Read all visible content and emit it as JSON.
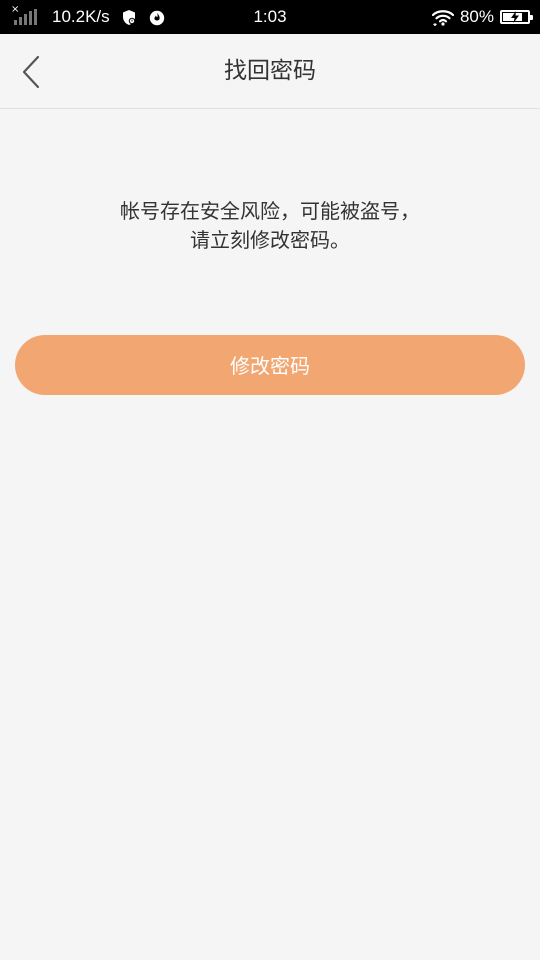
{
  "status_bar": {
    "net_speed": "10.2K/s",
    "time": "1:03",
    "battery_percent": "80%",
    "battery_level": 0.8,
    "signal_no_sim_mark": "×",
    "icons": [
      "signal-icon",
      "shield-icon",
      "fire-icon",
      "wifi-icon",
      "battery-charging-icon"
    ]
  },
  "nav": {
    "title": "找回密码",
    "back_icon": "chevron-left-icon"
  },
  "message": {
    "line1": "帐号存在安全风险，可能被盗号，",
    "line2": "请立刻修改密码。"
  },
  "action": {
    "change_password_label": "修改密码"
  },
  "colors": {
    "background": "#f5f5f6",
    "button": "#f2a672",
    "title_text": "#333333",
    "status_bar": "#000000"
  }
}
